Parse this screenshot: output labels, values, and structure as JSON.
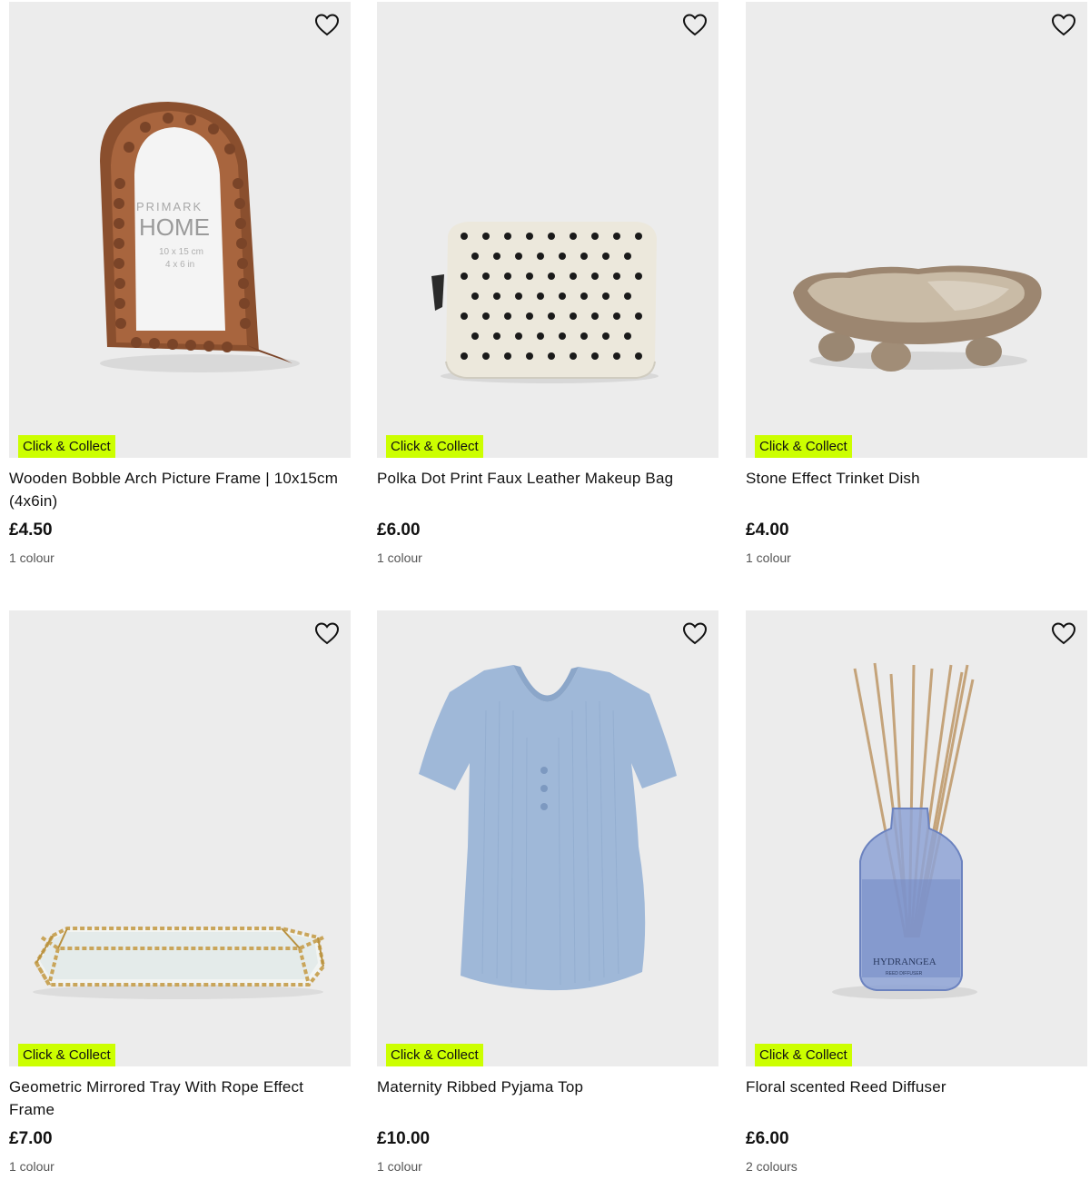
{
  "products": [
    {
      "title": "Wooden Bobble Arch Picture Frame | 10x15cm (4x6in)",
      "badge": "Click & Collect",
      "price": "£4.50",
      "colours": "1 colour",
      "image": "arch-photo-frame-image",
      "frame_text": {
        "brand": "PRIMARK",
        "home": "HOME",
        "size1": "10 x 15 cm",
        "size2": "4 x 6 in"
      }
    },
    {
      "title": "Polka Dot Print Faux Leather Makeup Bag",
      "badge": "Click & Collect",
      "price": "£6.00",
      "colours": "1 colour",
      "image": "polka-dot-makeup-bag-image"
    },
    {
      "title": "Stone Effect Trinket Dish",
      "badge": "Click & Collect",
      "price": "£4.00",
      "colours": "1 colour",
      "image": "trinket-dish-image"
    },
    {
      "title": "Geometric Mirrored Tray With Rope Effect Frame",
      "badge": "Click & Collect",
      "price": "£7.00",
      "colours": "1 colour",
      "image": "mirrored-tray-image"
    },
    {
      "title": "Maternity Ribbed Pyjama Top",
      "badge": "Click & Collect",
      "price": "£10.00",
      "colours": "1 colour",
      "image": "pyjama-top-image"
    },
    {
      "title": "Floral scented Reed Diffuser",
      "badge": "Click & Collect",
      "price": "£6.00",
      "colours": "2 colours",
      "image": "reed-diffuser-image",
      "label_text": {
        "name": "HYDRANGEA",
        "sub": "REED DIFFUSER"
      }
    }
  ],
  "colors": {
    "badge": "#ccff00",
    "image_bg": "#ececec",
    "text": "#111111",
    "muted": "#555555"
  },
  "icons": {
    "wishlist": "heart-outline-icon"
  }
}
